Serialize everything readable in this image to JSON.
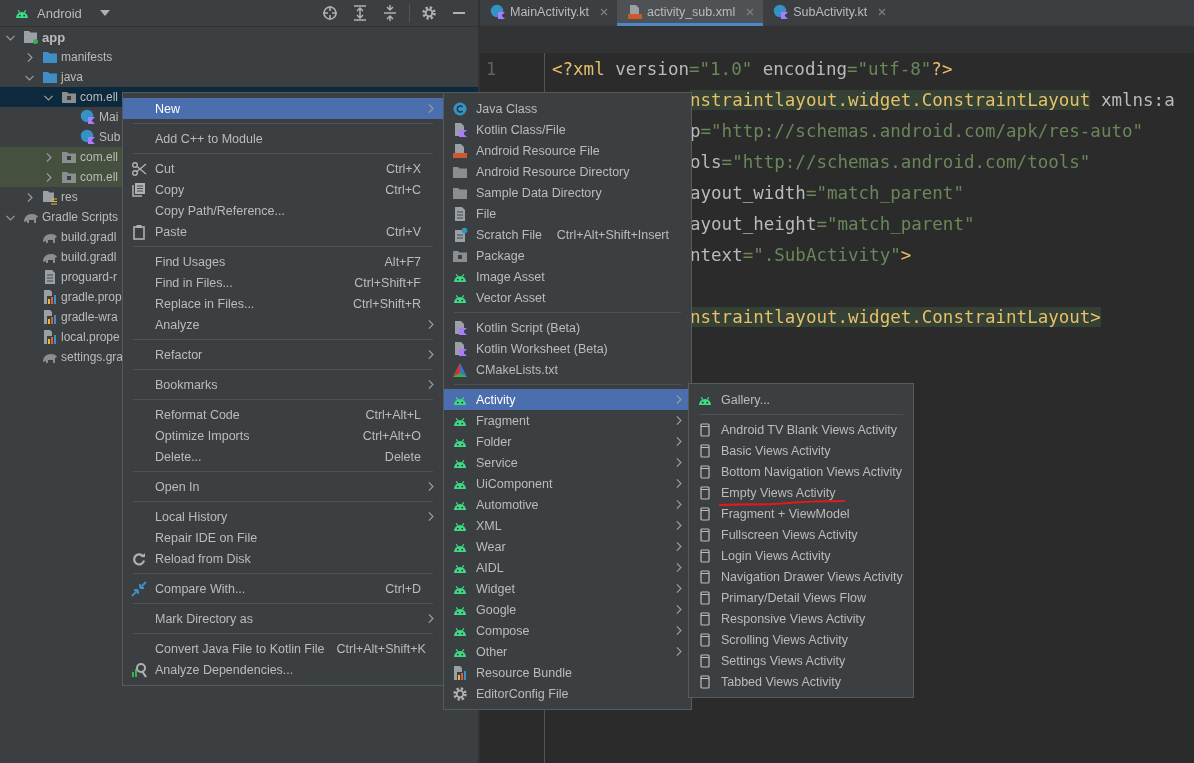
{
  "project_panel": {
    "title": "Android",
    "tree": [
      {
        "label": "app",
        "kind": "module",
        "expanded": true,
        "selected": false,
        "tinted": false,
        "children": [
          {
            "label": "manifests",
            "kind": "bluefolder",
            "expanded": false,
            "selected": false,
            "tinted": false
          },
          {
            "label": "java",
            "kind": "bluefolder",
            "expanded": true,
            "selected": false,
            "tinted": false,
            "children": [
              {
                "label": "com.ell",
                "kind": "package",
                "expanded": true,
                "selected": true,
                "tinted": false,
                "children": [
                  {
                    "label": "Mai",
                    "kind": "kclass",
                    "selected": false,
                    "tinted": false
                  },
                  {
                    "label": "Sub",
                    "kind": "kclass",
                    "selected": false,
                    "tinted": false
                  }
                ]
              },
              {
                "label": "com.ell",
                "kind": "package",
                "expanded": false,
                "selected": false,
                "tinted": true
              },
              {
                "label": "com.ell",
                "kind": "package",
                "expanded": false,
                "selected": false,
                "tinted": true
              }
            ]
          },
          {
            "label": "res",
            "kind": "resfolder",
            "expanded": false,
            "selected": false,
            "tinted": false
          }
        ]
      },
      {
        "label": "Gradle Scripts",
        "kind": "gradle",
        "expanded": true,
        "selected": false,
        "tinted": false,
        "children": [
          {
            "label": "build.gradl",
            "kind": "gradle",
            "selected": false,
            "tinted": false
          },
          {
            "label": "build.gradl",
            "kind": "gradle",
            "selected": false,
            "tinted": false
          },
          {
            "label": "proguard-r",
            "kind": "file",
            "selected": false,
            "tinted": false
          },
          {
            "label": "gradle.prop",
            "kind": "props",
            "selected": false,
            "tinted": false
          },
          {
            "label": "gradle-wra",
            "kind": "props",
            "selected": false,
            "tinted": false
          },
          {
            "label": "local.prope",
            "kind": "props",
            "selected": false,
            "tinted": false
          },
          {
            "label": "settings.gra",
            "kind": "gradle",
            "selected": false,
            "tinted": false
          }
        ]
      }
    ]
  },
  "editor": {
    "tabs": [
      {
        "label": "MainActivity.kt",
        "kind": "kotlin",
        "selected": false
      },
      {
        "label": "activity_sub.xml",
        "kind": "xml",
        "selected": true
      },
      {
        "label": "SubActivity.kt",
        "kind": "kotlin",
        "selected": false
      }
    ],
    "gutter": [
      "1"
    ],
    "lines": [
      {
        "segments": [
          {
            "text": "<?xml ",
            "kind": "tag",
            "matched": false
          },
          {
            "text": "version",
            "kind": "attr",
            "matched": false
          },
          {
            "text": "=\"1.0\" ",
            "kind": "value",
            "matched": false
          },
          {
            "text": "encoding",
            "kind": "attr",
            "matched": false
          },
          {
            "text": "=\"utf-8\"",
            "kind": "value",
            "matched": false
          },
          {
            "text": "?>",
            "kind": "tag",
            "matched": false
          }
        ]
      },
      {
        "segments": [
          {
            "text": "nstraintlayout.widget.ConstraintLayout",
            "kind": "tag",
            "matched": true
          },
          {
            "text": " xmlns:a",
            "kind": "attr",
            "matched": false
          }
        ]
      },
      {
        "segments": [
          {
            "text": "p",
            "kind": "attr",
            "matched": false
          },
          {
            "text": "=\"http://schemas.android.com/apk/res-auto\"",
            "kind": "value",
            "matched": false
          }
        ]
      },
      {
        "segments": [
          {
            "text": "ols",
            "kind": "attr",
            "matched": false
          },
          {
            "text": "=\"http://schemas.android.com/tools\"",
            "kind": "value",
            "matched": false
          }
        ]
      },
      {
        "segments": [
          {
            "text": "ayout_width",
            "kind": "attr",
            "matched": false
          },
          {
            "text": "=\"match_parent\"",
            "kind": "value",
            "matched": false
          }
        ]
      },
      {
        "segments": [
          {
            "text": "ayout_height",
            "kind": "attr",
            "matched": false
          },
          {
            "text": "=\"match_parent\"",
            "kind": "value",
            "matched": false
          }
        ]
      },
      {
        "segments": [
          {
            "text": "ntext",
            "kind": "attr",
            "matched": false
          },
          {
            "text": "=\".SubActivity\"",
            "kind": "value",
            "matched": false
          },
          {
            "text": ">",
            "kind": "tag",
            "matched": false
          }
        ]
      },
      {
        "kind": "blank"
      },
      {
        "segments": [
          {
            "text": "nstraintlayout.widget.ConstraintLayout>",
            "kind": "tag",
            "matched": true
          }
        ]
      }
    ]
  },
  "context_menu": {
    "groups": [
      [
        {
          "label": "New",
          "kind": "plain",
          "submenu": true,
          "selected": true
        }
      ],
      [
        {
          "label": "Add C++ to Module",
          "kind": "plain",
          "submenu": false,
          "selected": false
        }
      ],
      [
        {
          "label": "Cut",
          "shortcut": "Ctrl+X",
          "kind": "scissors",
          "submenu": false,
          "selected": false
        },
        {
          "label": "Copy",
          "shortcut": "Ctrl+C",
          "kind": "copy",
          "submenu": false,
          "selected": false
        },
        {
          "label": "Copy Path/Reference...",
          "kind": "plain",
          "submenu": false,
          "selected": false
        },
        {
          "label": "Paste",
          "shortcut": "Ctrl+V",
          "kind": "paste",
          "submenu": false,
          "selected": false
        }
      ],
      [
        {
          "label": "Find Usages",
          "shortcut": "Alt+F7",
          "kind": "plain",
          "submenu": false,
          "selected": false
        },
        {
          "label": "Find in Files...",
          "shortcut": "Ctrl+Shift+F",
          "kind": "plain",
          "submenu": false,
          "selected": false
        },
        {
          "label": "Replace in Files...",
          "shortcut": "Ctrl+Shift+R",
          "kind": "plain",
          "submenu": false,
          "selected": false
        },
        {
          "label": "Analyze",
          "kind": "plain",
          "submenu": true,
          "selected": false
        }
      ],
      [
        {
          "label": "Refactor",
          "kind": "plain",
          "submenu": true,
          "selected": false
        }
      ],
      [
        {
          "label": "Bookmarks",
          "kind": "plain",
          "submenu": true,
          "selected": false
        }
      ],
      [
        {
          "label": "Reformat Code",
          "shortcut": "Ctrl+Alt+L",
          "kind": "plain",
          "submenu": false,
          "selected": false
        },
        {
          "label": "Optimize Imports",
          "shortcut": "Ctrl+Alt+O",
          "kind": "plain",
          "submenu": false,
          "selected": false
        },
        {
          "label": "Delete...",
          "shortcut": "Delete",
          "kind": "plain",
          "submenu": false,
          "selected": false
        }
      ],
      [
        {
          "label": "Open In",
          "kind": "plain",
          "submenu": true,
          "selected": false
        }
      ],
      [
        {
          "label": "Local History",
          "kind": "plain",
          "submenu": true,
          "selected": false
        },
        {
          "label": "Repair IDE on File",
          "kind": "plain",
          "submenu": false,
          "selected": false
        },
        {
          "label": "Reload from Disk",
          "kind": "reload",
          "submenu": false,
          "selected": false
        }
      ],
      [
        {
          "label": "Compare With...",
          "shortcut": "Ctrl+D",
          "kind": "compare",
          "submenu": false,
          "selected": false
        }
      ],
      [
        {
          "label": "Mark Directory as",
          "kind": "plain",
          "submenu": true,
          "selected": false
        }
      ],
      [
        {
          "label": "Convert Java File to Kotlin File",
          "shortcut": "Ctrl+Alt+Shift+K",
          "kind": "plain",
          "submenu": false,
          "selected": false
        },
        {
          "label": "Analyze Dependencies...",
          "kind": "deps",
          "submenu": false,
          "selected": false
        }
      ]
    ]
  },
  "new_submenu": {
    "groups": [
      [
        {
          "label": "Java Class",
          "kind": "class",
          "submenu": false,
          "selected": false
        },
        {
          "label": "Kotlin Class/File",
          "kind": "kotlin",
          "submenu": false,
          "selected": false
        },
        {
          "label": "Android Resource File",
          "kind": "resource",
          "submenu": false,
          "selected": false
        },
        {
          "label": "Android Resource Directory",
          "kind": "folder",
          "submenu": false,
          "selected": false
        },
        {
          "label": "Sample Data Directory",
          "kind": "folder",
          "submenu": false,
          "selected": false
        },
        {
          "label": "File",
          "kind": "file",
          "submenu": false,
          "selected": false
        },
        {
          "label": "Scratch File",
          "shortcut": "Ctrl+Alt+Shift+Insert",
          "kind": "scratch",
          "submenu": false,
          "selected": false
        },
        {
          "label": "Package",
          "kind": "package",
          "submenu": false,
          "selected": false
        },
        {
          "label": "Image Asset",
          "kind": "android",
          "submenu": false,
          "selected": false
        },
        {
          "label": "Vector Asset",
          "kind": "android",
          "submenu": false,
          "selected": false
        }
      ],
      [
        {
          "label": "Kotlin Script (Beta)",
          "kind": "kotlin",
          "submenu": false,
          "selected": false
        },
        {
          "label": "Kotlin Worksheet (Beta)",
          "kind": "kotlin",
          "submenu": false,
          "selected": false
        },
        {
          "label": "CMakeLists.txt",
          "kind": "cmake",
          "submenu": false,
          "selected": false
        }
      ],
      [
        {
          "label": "Activity",
          "kind": "android",
          "submenu": true,
          "selected": true
        },
        {
          "label": "Fragment",
          "kind": "android",
          "submenu": true,
          "selected": false
        },
        {
          "label": "Folder",
          "kind": "android",
          "submenu": true,
          "selected": false
        },
        {
          "label": "Service",
          "kind": "android",
          "submenu": true,
          "selected": false
        },
        {
          "label": "UiComponent",
          "kind": "android",
          "submenu": true,
          "selected": false
        },
        {
          "label": "Automotive",
          "kind": "android",
          "submenu": true,
          "selected": false
        },
        {
          "label": "XML",
          "kind": "android",
          "submenu": true,
          "selected": false
        },
        {
          "label": "Wear",
          "kind": "android",
          "submenu": true,
          "selected": false
        },
        {
          "label": "AIDL",
          "kind": "android",
          "submenu": true,
          "selected": false
        },
        {
          "label": "Widget",
          "kind": "android",
          "submenu": true,
          "selected": false
        },
        {
          "label": "Google",
          "kind": "android",
          "submenu": true,
          "selected": false
        },
        {
          "label": "Compose",
          "kind": "android",
          "submenu": true,
          "selected": false
        },
        {
          "label": "Other",
          "kind": "android",
          "submenu": true,
          "selected": false
        },
        {
          "label": "Resource Bundle",
          "kind": "bundle",
          "submenu": false,
          "selected": false
        },
        {
          "label": "EditorConfig File",
          "kind": "gear",
          "submenu": false,
          "selected": false
        }
      ]
    ]
  },
  "activity_submenu": {
    "groups": [
      [
        {
          "label": "Gallery...",
          "kind": "android",
          "submenu": false,
          "selected": false,
          "underlined": false
        }
      ],
      [
        {
          "label": "Android TV Blank Views Activity",
          "kind": "template",
          "submenu": false,
          "selected": false,
          "underlined": false
        },
        {
          "label": "Basic Views Activity",
          "kind": "template",
          "submenu": false,
          "selected": false,
          "underlined": false
        },
        {
          "label": "Bottom Navigation Views Activity",
          "kind": "template",
          "submenu": false,
          "selected": false,
          "underlined": false
        },
        {
          "label": "Empty Views Activity",
          "kind": "template",
          "submenu": false,
          "selected": false,
          "underlined": true
        },
        {
          "label": "Fragment + ViewModel",
          "kind": "template",
          "submenu": false,
          "selected": false,
          "underlined": false
        },
        {
          "label": "Fullscreen Views Activity",
          "kind": "template",
          "submenu": false,
          "selected": false,
          "underlined": false
        },
        {
          "label": "Login Views Activity",
          "kind": "template",
          "submenu": false,
          "selected": false,
          "underlined": false
        },
        {
          "label": "Navigation Drawer Views Activity",
          "kind": "template",
          "submenu": false,
          "selected": false,
          "underlined": false
        },
        {
          "label": "Primary/Detail Views Flow",
          "kind": "template",
          "submenu": false,
          "selected": false,
          "underlined": false
        },
        {
          "label": "Responsive Views Activity",
          "kind": "template",
          "submenu": false,
          "selected": false,
          "underlined": false
        },
        {
          "label": "Scrolling Views Activity",
          "kind": "template",
          "submenu": false,
          "selected": false,
          "underlined": false
        },
        {
          "label": "Settings Views Activity",
          "kind": "template",
          "submenu": false,
          "selected": false,
          "underlined": false
        },
        {
          "label": "Tabbed Views Activity",
          "kind": "template",
          "submenu": false,
          "selected": false,
          "underlined": false
        }
      ]
    ]
  }
}
